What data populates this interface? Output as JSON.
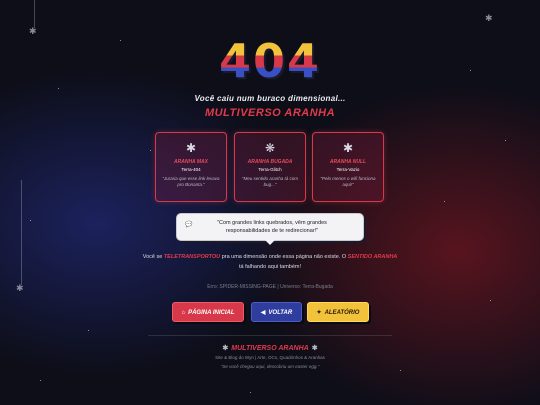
{
  "error_code": "404",
  "subtitle": "Você caiu num buraco dimensional...",
  "brand": "MULTIVERSO ARANHA",
  "cards": [
    {
      "icon": "spider-icon",
      "name": "ARANHA MAX",
      "universe": "Terra-404",
      "quote": "\"Juraria que esse link levava pro Bonanta.\""
    },
    {
      "icon": "web-icon",
      "name": "ARANHA BUGADA",
      "universe": "Terra-Glitch",
      "quote": "\"Meu sentido aranha tá com bug...\""
    },
    {
      "icon": "spider-icon",
      "name": "ARANHA NULL",
      "universe": "Terra-Vazio",
      "quote": "\"Pelo menos o wifi funciona aqui!\""
    }
  ],
  "bubble": {
    "icon": "chat-icon",
    "text": "\"Com grandes links quebrados, vêm grandes responsabilidades de te redirecionar!\""
  },
  "paragraph": {
    "p1": "Você se",
    "h1": "TELETRANSPORTOU",
    "p2": "pra uma dimensão onde essa página não existe. O",
    "h2": "SENTIDO ARANHA",
    "p3": "tá falhando aqui também!"
  },
  "error_line": "Erro: SPIDER-MISSING-PAGE | Universo: Terra-Bugada",
  "buttons": {
    "home": {
      "icon": "home-icon",
      "label": "PÁGINA INICIAL"
    },
    "back": {
      "icon": "back-icon",
      "label": "VOLTAR"
    },
    "random": {
      "icon": "shuffle-icon",
      "label": "ALEATÓRIO"
    }
  },
  "footer": {
    "brand": "MULTIVERSO ARANHA",
    "description": "Site & Blog do Wyn | Arte, OCs, Quadrinhos & Aranhas",
    "quote": "\"Se você chegou aqui, descobriu um easter egg.\""
  },
  "colors": {
    "background": "#0d0e18",
    "accent_red": "#d8394a",
    "accent_blue": "#2f3d9e",
    "accent_yellow": "#f2c33a"
  }
}
